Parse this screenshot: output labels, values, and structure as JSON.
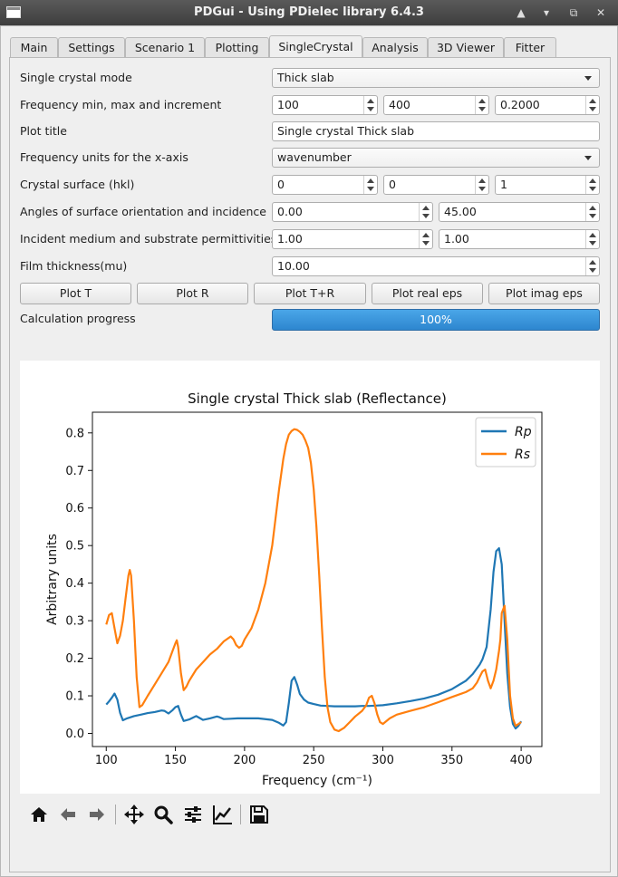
{
  "window": {
    "title": "PDGui - Using PDielec library 6.4.3"
  },
  "tabs": [
    {
      "label": "Main"
    },
    {
      "label": "Settings"
    },
    {
      "label": "Scenario 1"
    },
    {
      "label": "Plotting"
    },
    {
      "label": "SingleCrystal",
      "active": true
    },
    {
      "label": "Analysis"
    },
    {
      "label": "3D Viewer"
    },
    {
      "label": "Fitter"
    }
  ],
  "form": {
    "mode_label": "Single crystal mode",
    "mode_value": "Thick slab",
    "freq_label": "Frequency min, max and increment",
    "freq_min": "100",
    "freq_max": "400",
    "freq_inc": "0.2000",
    "title_label": "Plot title",
    "title_value": "Single crystal Thick slab",
    "units_label": "Frequency units for the x-axis",
    "units_value": "wavenumber",
    "hkl_label": "Crystal surface (hkl)",
    "h": "0",
    "k": "0",
    "l": "1",
    "angles_label": "Angles of surface orientation and incidence",
    "angle_orient": "0.00",
    "angle_incidence": "45.00",
    "perm_label": "Incident medium and substrate permittivities",
    "perm_incident": "1.00",
    "perm_substrate": "1.00",
    "film_label": "Film thickness(mu)",
    "film_value": "10.00",
    "progress_label": "Calculation progress",
    "progress_text": "100%",
    "progress_value": 1.0
  },
  "buttons": {
    "plot_t": "Plot T",
    "plot_r": "Plot R",
    "plot_tr": "Plot T+R",
    "plot_real": "Plot real eps",
    "plot_imag": "Plot imag eps"
  },
  "chart_data": {
    "type": "line",
    "title": "Single crystal Thick slab (Reflectance)",
    "xlabel": "Frequency (cm⁻¹)",
    "ylabel": "Arbitrary units",
    "xlim": [
      90,
      415
    ],
    "ylim": [
      -0.035,
      0.855
    ],
    "xticks": [
      100,
      150,
      200,
      250,
      300,
      350,
      400
    ],
    "yticks": [
      0.0,
      0.1,
      0.2,
      0.3,
      0.4,
      0.5,
      0.6,
      0.7,
      0.8
    ],
    "grid": false,
    "legend_position": "top-right",
    "series": [
      {
        "name": "Rp",
        "color": "#1f77b4",
        "x": [
          100,
          102,
          104,
          106,
          108,
          110,
          112,
          115,
          120,
          125,
          130,
          135,
          140,
          142,
          145,
          148,
          150,
          152,
          154,
          156,
          160,
          165,
          170,
          175,
          180,
          182,
          185,
          190,
          195,
          200,
          210,
          220,
          225,
          228,
          230,
          232,
          234,
          236,
          238,
          240,
          243,
          246,
          250,
          255,
          260,
          265,
          270,
          275,
          280,
          285,
          290,
          295,
          300,
          310,
          320,
          330,
          340,
          350,
          360,
          365,
          370,
          372,
          375,
          378,
          380,
          382,
          384,
          386,
          388,
          390,
          392,
          394,
          396,
          398,
          400
        ],
        "y": [
          0.077,
          0.085,
          0.095,
          0.106,
          0.09,
          0.055,
          0.035,
          0.04,
          0.046,
          0.05,
          0.054,
          0.057,
          0.061,
          0.06,
          0.053,
          0.062,
          0.07,
          0.073,
          0.05,
          0.033,
          0.037,
          0.046,
          0.036,
          0.04,
          0.045,
          0.043,
          0.038,
          0.039,
          0.04,
          0.04,
          0.04,
          0.036,
          0.028,
          0.021,
          0.03,
          0.08,
          0.14,
          0.15,
          0.13,
          0.105,
          0.09,
          0.082,
          0.078,
          0.074,
          0.073,
          0.072,
          0.072,
          0.072,
          0.072,
          0.073,
          0.073,
          0.074,
          0.075,
          0.08,
          0.086,
          0.093,
          0.103,
          0.118,
          0.14,
          0.158,
          0.183,
          0.197,
          0.23,
          0.33,
          0.43,
          0.485,
          0.493,
          0.45,
          0.3,
          0.16,
          0.07,
          0.025,
          0.013,
          0.02,
          0.032
        ]
      },
      {
        "name": "Rs",
        "color": "#ff7f0e",
        "x": [
          100,
          102,
          104,
          106,
          108,
          110,
          112,
          114,
          116,
          117,
          118,
          120,
          122,
          124,
          126,
          130,
          135,
          140,
          145,
          148,
          150,
          151,
          152,
          154,
          156,
          158,
          160,
          165,
          170,
          175,
          180,
          185,
          190,
          192,
          194,
          196,
          198,
          200,
          205,
          210,
          215,
          220,
          225,
          228,
          230,
          232,
          234,
          236,
          238,
          240,
          242,
          244,
          246,
          248,
          250,
          252,
          254,
          256,
          258,
          260,
          262,
          265,
          268,
          272,
          276,
          280,
          285,
          288,
          290,
          292,
          294,
          296,
          298,
          300,
          305,
          310,
          320,
          330,
          340,
          350,
          360,
          365,
          368,
          370,
          372,
          374,
          376,
          378,
          380,
          382,
          384,
          385,
          386,
          388,
          390,
          392,
          394,
          396,
          398,
          400
        ],
        "y": [
          0.29,
          0.315,
          0.32,
          0.28,
          0.24,
          0.26,
          0.3,
          0.36,
          0.42,
          0.435,
          0.42,
          0.3,
          0.15,
          0.07,
          0.075,
          0.1,
          0.13,
          0.16,
          0.19,
          0.22,
          0.24,
          0.248,
          0.23,
          0.16,
          0.115,
          0.125,
          0.14,
          0.17,
          0.19,
          0.21,
          0.225,
          0.245,
          0.258,
          0.25,
          0.235,
          0.228,
          0.233,
          0.25,
          0.28,
          0.33,
          0.4,
          0.5,
          0.65,
          0.73,
          0.77,
          0.795,
          0.805,
          0.81,
          0.808,
          0.803,
          0.795,
          0.78,
          0.76,
          0.72,
          0.65,
          0.55,
          0.42,
          0.28,
          0.15,
          0.07,
          0.03,
          0.01,
          0.006,
          0.015,
          0.03,
          0.045,
          0.06,
          0.075,
          0.095,
          0.1,
          0.08,
          0.05,
          0.03,
          0.025,
          0.04,
          0.05,
          0.06,
          0.07,
          0.083,
          0.097,
          0.11,
          0.12,
          0.135,
          0.15,
          0.165,
          0.17,
          0.14,
          0.12,
          0.14,
          0.17,
          0.22,
          0.25,
          0.32,
          0.34,
          0.25,
          0.1,
          0.04,
          0.02,
          0.025,
          0.03
        ]
      }
    ]
  },
  "toolbar": {
    "icons": [
      "home-icon",
      "back-icon",
      "forward-icon",
      "pan-icon",
      "zoom-icon",
      "configure-subplots-icon",
      "edit-axis-icon",
      "save-icon"
    ]
  }
}
